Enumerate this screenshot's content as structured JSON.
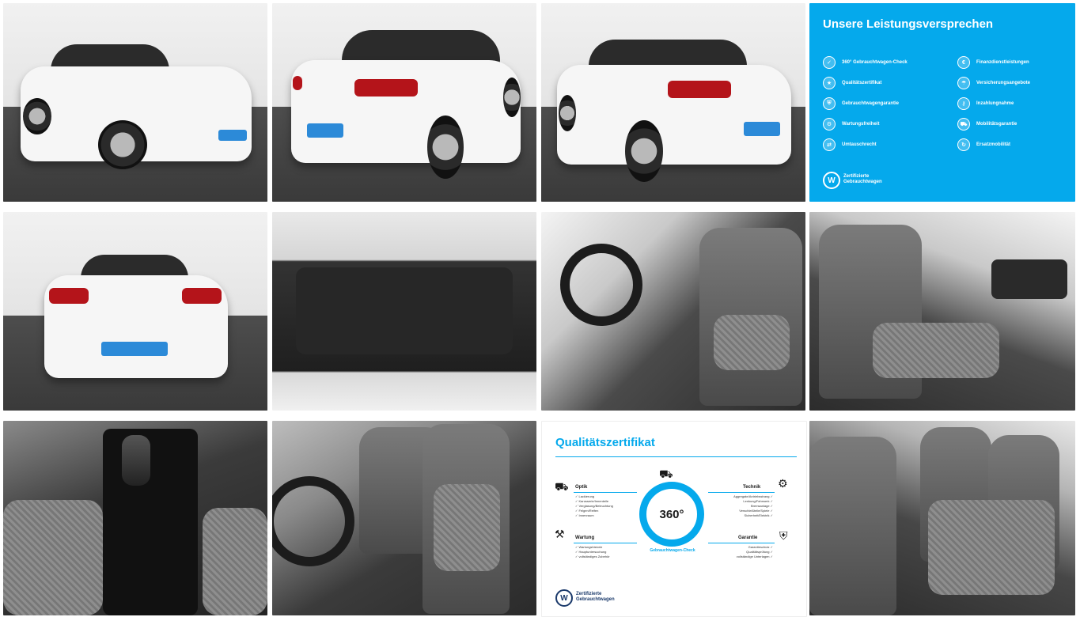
{
  "gallery": {
    "images": [
      {
        "name": "front-three-quarter"
      },
      {
        "name": "rear-three-quarter-right"
      },
      {
        "name": "rear-three-quarter-left"
      },
      {
        "name": "promise-panel"
      },
      {
        "name": "rear"
      },
      {
        "name": "trunk"
      },
      {
        "name": "front-seats-driver"
      },
      {
        "name": "front-seats-passenger"
      },
      {
        "name": "gear-shifter"
      },
      {
        "name": "front-seats-angle"
      },
      {
        "name": "quality-certificate"
      },
      {
        "name": "rear-seats"
      }
    ]
  },
  "promise_panel": {
    "title": "Unsere Leistungsversprechen",
    "left_items": [
      "360° Gebrauchtwagen-Check",
      "Qualitätszertifikat",
      "Gebrauchtwagengarantie",
      "Wartungsfreiheit",
      "Umtauschrecht"
    ],
    "right_items": [
      "Finanzdienstleistungen",
      "Versicherungsangebote",
      "Inzahlungnahme",
      "Mobilitätsgarantie",
      "Ersatzmobilität"
    ],
    "brand_line1": "Zertifizierte",
    "brand_line2": "Gebrauchtwagen"
  },
  "certificate": {
    "title": "Qualitätszertifikat",
    "badge_number": "360°",
    "badge_caption": "Gebrauchtwagen-Check",
    "optik": {
      "label": "Optik",
      "items": [
        "✓ Lackierung",
        "✓ Karosserie/Innenteile",
        "✓ Verglasung/Beleuchtung",
        "✓ Felgen/Reifen",
        "✓ Innenraum"
      ]
    },
    "technik": {
      "label": "Technik",
      "items": [
        "Aggregate/Antriebsstrang ✓",
        "Lenkung/Fahrwerk ✓",
        "Bremsanlage ✓",
        "Verschleißteile/Spiele ✓",
        "Sicherheit/Elektrik ✓"
      ]
    },
    "wartung": {
      "label": "Wartung",
      "items": [
        "✓ Wartungshistorie",
        "✓ Hauptuntersuchung",
        "✓ vollständiges Zubehör"
      ]
    },
    "garantie": {
      "label": "Garantie",
      "items": [
        "Garantieschutz ✓",
        "Qualitätsprüfung ✓",
        "vollständige Unterlagen ✓"
      ]
    },
    "brand_line1": "Zertifizierte",
    "brand_line2": "Gebrauchtwagen"
  },
  "colors": {
    "accent": "#05a9ec",
    "car_white": "#f6f6f6",
    "tail_red": "#b4141a"
  }
}
